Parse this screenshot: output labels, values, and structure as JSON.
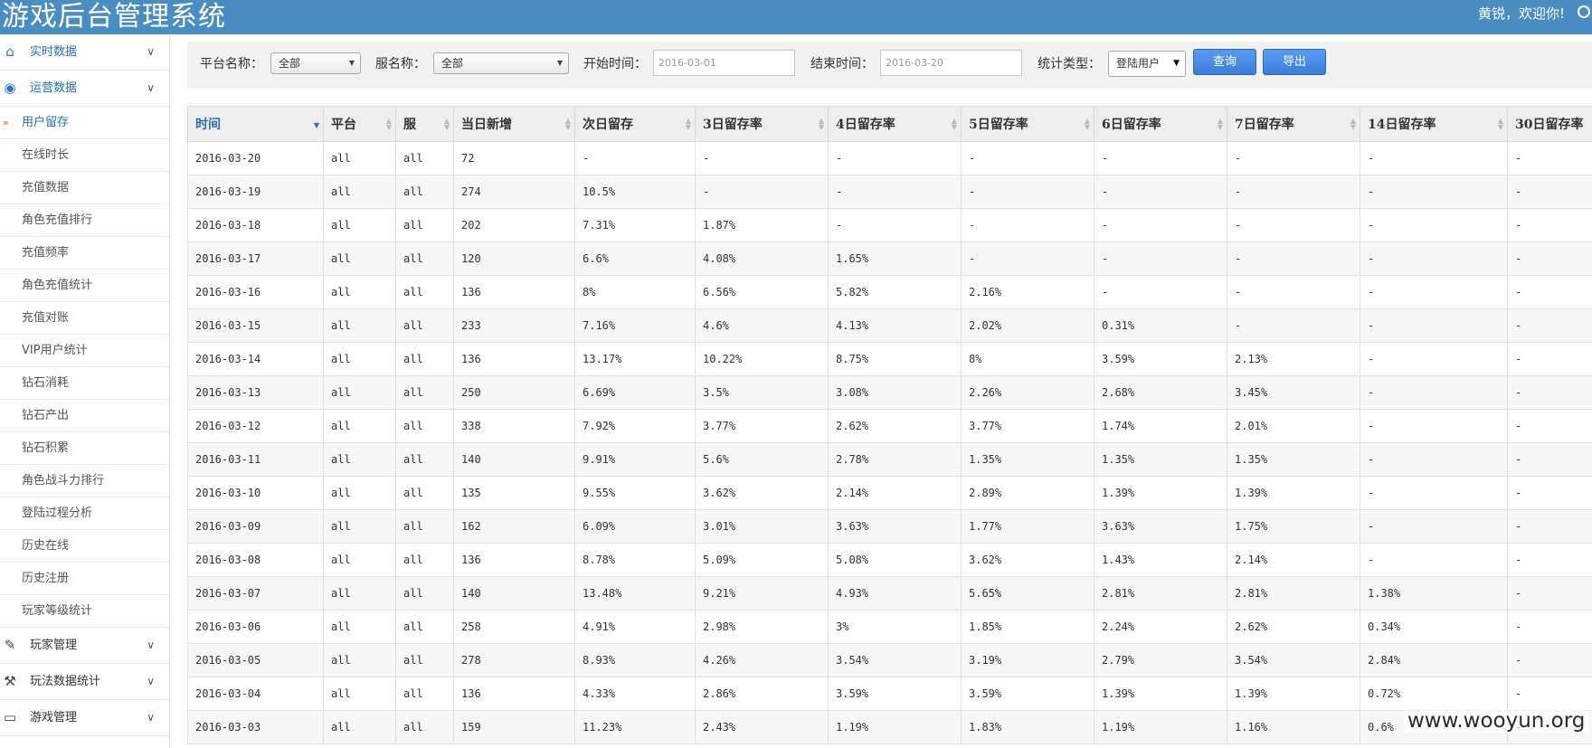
{
  "header": {
    "title": "游戏后台管理系统",
    "welcome": "黄锐，欢迎你!"
  },
  "sidebar": {
    "groups": [
      {
        "label": "实时数据",
        "icon": "home-icon"
      },
      {
        "label": "运营数据",
        "icon": "dashboard-icon"
      },
      {
        "label": "玩家管理",
        "icon": "edit-icon"
      },
      {
        "label": "玩法数据统计",
        "icon": "gavel-icon"
      },
      {
        "label": "游戏管理",
        "icon": "laptop-icon"
      }
    ],
    "items": [
      "用户留存",
      "在线时长",
      "充值数据",
      "角色充值排行",
      "充值频率",
      "角色充值统计",
      "充值对账",
      "VIP用户统计",
      "钻石消耗",
      "钻石产出",
      "钻石积累",
      "角色战斗力排行",
      "登陆过程分析",
      "历史在线",
      "历史注册",
      "玩家等级统计"
    ],
    "active_item": "用户留存"
  },
  "filter": {
    "platform_label": "平台名称：",
    "platform_value": "全部",
    "server_label": "服名称：",
    "server_value": "全部",
    "start_label": "开始时间：",
    "start_value": "2016-03-01",
    "end_label": "结束时间：",
    "end_value": "2016-03-20",
    "type_label": "统计类型：",
    "type_value": "登陆用户",
    "query_button": "查询",
    "export_button": "导出"
  },
  "table": {
    "headers": [
      "时间",
      "平台",
      "服",
      "当日新增",
      "次日留存",
      "3日留存率",
      "4日留存率",
      "5日留存率",
      "6日留存率",
      "7日留存率",
      "14日留存率",
      "30日留存率"
    ],
    "rows": [
      [
        "2016-03-20",
        "all",
        "all",
        "72",
        "-",
        "-",
        "-",
        "-",
        "-",
        "-",
        "-",
        "-"
      ],
      [
        "2016-03-19",
        "all",
        "all",
        "274",
        "10.5%",
        "-",
        "-",
        "-",
        "-",
        "-",
        "-",
        "-"
      ],
      [
        "2016-03-18",
        "all",
        "all",
        "202",
        "7.31%",
        "1.87%",
        "-",
        "-",
        "-",
        "-",
        "-",
        "-"
      ],
      [
        "2016-03-17",
        "all",
        "all",
        "120",
        "6.6%",
        "4.08%",
        "1.65%",
        "-",
        "-",
        "-",
        "-",
        "-"
      ],
      [
        "2016-03-16",
        "all",
        "all",
        "136",
        "8%",
        "6.56%",
        "5.82%",
        "2.16%",
        "-",
        "-",
        "-",
        "-"
      ],
      [
        "2016-03-15",
        "all",
        "all",
        "233",
        "7.16%",
        "4.6%",
        "4.13%",
        "2.02%",
        "0.31%",
        "-",
        "-",
        "-"
      ],
      [
        "2016-03-14",
        "all",
        "all",
        "136",
        "13.17%",
        "10.22%",
        "8.75%",
        "8%",
        "3.59%",
        "2.13%",
        "-",
        "-"
      ],
      [
        "2016-03-13",
        "all",
        "all",
        "250",
        "6.69%",
        "3.5%",
        "3.08%",
        "2.26%",
        "2.68%",
        "3.45%",
        "-",
        "-"
      ],
      [
        "2016-03-12",
        "all",
        "all",
        "338",
        "7.92%",
        "3.77%",
        "2.62%",
        "3.77%",
        "1.74%",
        "2.01%",
        "-",
        "-"
      ],
      [
        "2016-03-11",
        "all",
        "all",
        "140",
        "9.91%",
        "5.6%",
        "2.78%",
        "1.35%",
        "1.35%",
        "1.35%",
        "-",
        "-"
      ],
      [
        "2016-03-10",
        "all",
        "all",
        "135",
        "9.55%",
        "3.62%",
        "2.14%",
        "2.89%",
        "1.39%",
        "1.39%",
        "-",
        "-"
      ],
      [
        "2016-03-09",
        "all",
        "all",
        "162",
        "6.09%",
        "3.01%",
        "3.63%",
        "1.77%",
        "3.63%",
        "1.75%",
        "-",
        "-"
      ],
      [
        "2016-03-08",
        "all",
        "all",
        "136",
        "8.78%",
        "5.09%",
        "5.08%",
        "3.62%",
        "1.43%",
        "2.14%",
        "-",
        "-"
      ],
      [
        "2016-03-07",
        "all",
        "all",
        "140",
        "13.48%",
        "9.21%",
        "4.93%",
        "5.65%",
        "2.81%",
        "2.81%",
        "1.38%",
        "-"
      ],
      [
        "2016-03-06",
        "all",
        "all",
        "258",
        "4.91%",
        "2.98%",
        "3%",
        "1.85%",
        "2.24%",
        "2.62%",
        "0.34%",
        "-"
      ],
      [
        "2016-03-05",
        "all",
        "all",
        "278",
        "8.93%",
        "4.26%",
        "3.54%",
        "3.19%",
        "2.79%",
        "3.54%",
        "2.84%",
        "-"
      ],
      [
        "2016-03-04",
        "all",
        "all",
        "136",
        "4.33%",
        "2.86%",
        "3.59%",
        "3.59%",
        "1.39%",
        "1.39%",
        "0.72%",
        "-"
      ],
      [
        "2016-03-03",
        "all",
        "all",
        "159",
        "11.23%",
        "2.43%",
        "1.19%",
        "1.83%",
        "1.19%",
        "1.16%",
        "0.6%",
        "-"
      ]
    ]
  },
  "watermark": "www.wooyun.org",
  "colors": {
    "header_bg": "#4a8dc1",
    "accent": "#2a6fad",
    "button": "#3b7ddd"
  }
}
